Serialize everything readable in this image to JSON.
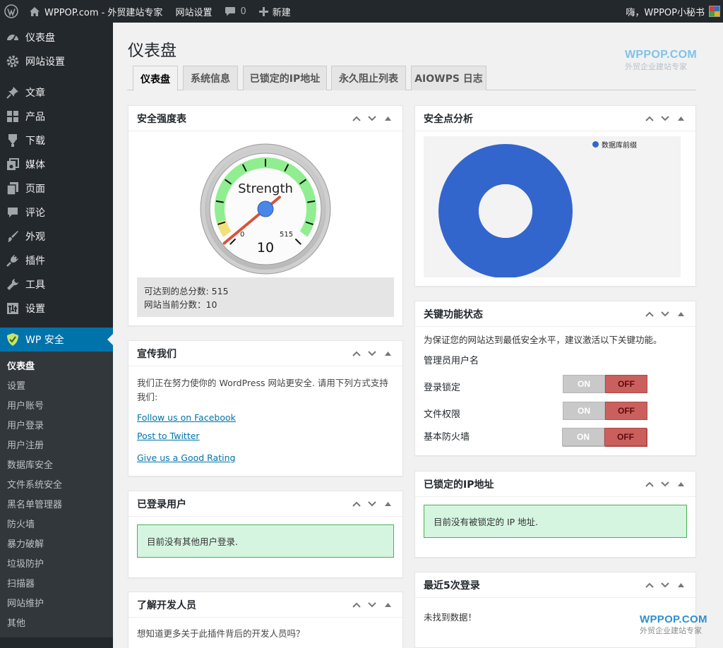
{
  "adminbar": {
    "site_name": "WPPOP.com - 外贸建站专家",
    "site_settings": "网站设置",
    "comments_count": "0",
    "new_label": "新建",
    "greeting": "嗨，WPPOP小秘书"
  },
  "sidebar": {
    "items": [
      {
        "label": "仪表盘",
        "icon": "dashboard-icon"
      },
      {
        "label": "网站设置",
        "icon": "gear-icon"
      },
      {
        "label": "文章",
        "icon": "pin-icon"
      },
      {
        "label": "产品",
        "icon": "grid-icon"
      },
      {
        "label": "下载",
        "icon": "download-icon"
      },
      {
        "label": "媒体",
        "icon": "media-icon"
      },
      {
        "label": "页面",
        "icon": "pages-icon"
      },
      {
        "label": "评论",
        "icon": "comment-icon"
      },
      {
        "label": "外观",
        "icon": "brush-icon"
      },
      {
        "label": "插件",
        "icon": "plug-icon"
      },
      {
        "label": "工具",
        "icon": "wrench-icon"
      },
      {
        "label": "设置",
        "icon": "settings-icon"
      },
      {
        "label": "WP 安全",
        "icon": "shield-icon"
      }
    ],
    "submenu": [
      "仪表盘",
      "设置",
      "用户账号",
      "用户登录",
      "用户注册",
      "数据库安全",
      "文件系统安全",
      "黑名单管理器",
      "防火墙",
      "暴力破解",
      "垃圾防护",
      "扫描器",
      "网站维护",
      "其他"
    ]
  },
  "page": {
    "title": "仪表盘",
    "watermark_top": {
      "brand": "WPPOP.COM",
      "tagline": "外贸企业建站专家"
    },
    "watermark_bottom": {
      "brand": "WPPOP.COM",
      "tagline": "外贸企业建站专家"
    }
  },
  "tabs": [
    "仪表盘",
    "系统信息",
    "已锁定的IP地址",
    "永久阻止列表",
    "AIOWPS 日志"
  ],
  "strength_box": {
    "title": "安全强度表",
    "gauge_label": "Strength",
    "gauge_min": "0",
    "gauge_max": "515",
    "gauge_value": "10",
    "value": 10,
    "max": 515,
    "total_line": "可达到的总分数: 515",
    "current_line": "网站当前分数：10"
  },
  "promote_box": {
    "title": "宣传我们",
    "text": "我们正在努力使你的 WordPress 网站更安全. 请用下列方式支持我们:",
    "links": [
      "Follow us on Facebook",
      "Post to Twitter",
      "Give us a Good Rating"
    ]
  },
  "loggedin_box": {
    "title": "已登录用户",
    "notice": "目前没有其他用户登录."
  },
  "developers_box": {
    "title": "了解开发人员",
    "text": "想知道更多关于此插件背后的开发人员吗？"
  },
  "analysis_box": {
    "title": "安全点分析",
    "legend": "数据库前缀"
  },
  "chart_data": {
    "type": "pie",
    "categories": [
      "数据库前缀"
    ],
    "values": [
      100
    ],
    "colors": [
      "#3366cc"
    ],
    "donut": true,
    "legend_position": "top-right"
  },
  "critical_box": {
    "title": "关键功能状态",
    "intro": "为保证您的网站达到最低安全水平，建议激活以下关键功能。",
    "on_label": "ON",
    "off_label": "OFF",
    "features": [
      "管理员用户名",
      "登录锁定",
      "文件权限",
      "基本防火墙"
    ]
  },
  "locked_box": {
    "title": "已锁定的IP地址",
    "notice": "目前没有被锁定的 IP 地址."
  },
  "recent_box": {
    "title": "最近5次登录",
    "text": "未找到数据！"
  },
  "colors": {
    "admin_bg": "#23282d",
    "accent": "#0073aa",
    "notice_bg": "#d5f5e0",
    "toggle_off": "#c9605e",
    "pie": "#3366cc"
  }
}
